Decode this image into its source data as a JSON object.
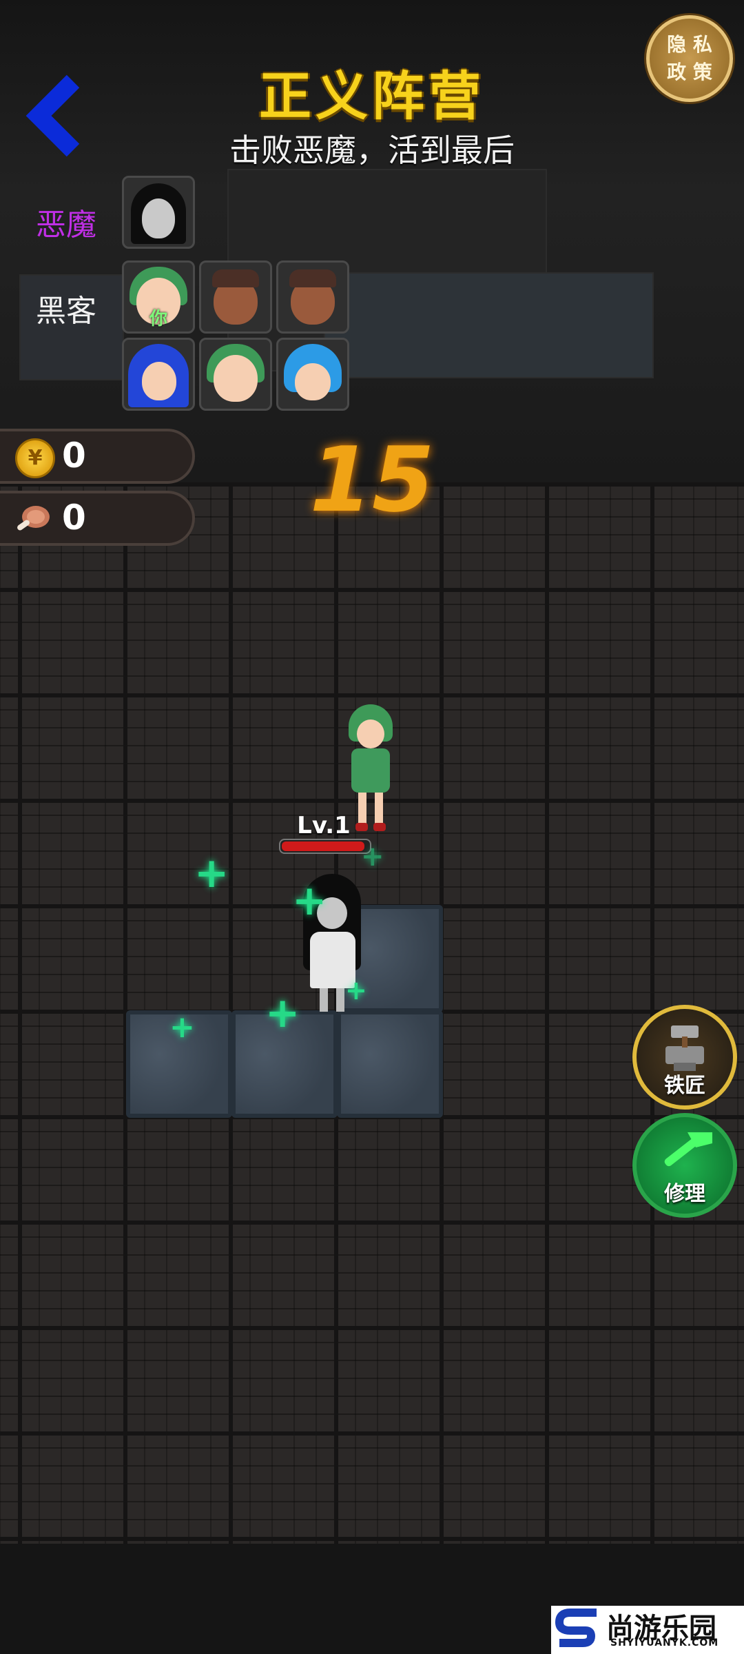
{
  "header": {
    "title": "正义阵营",
    "subtitle": "击败恶魔，活到最后",
    "privacy_label": "隐私政策",
    "privacy_line1": "隐 私",
    "privacy_line2": "政 策"
  },
  "teams": {
    "demon_label": "恶魔",
    "hacker_label": "黑客",
    "you_label": "你",
    "demon_color": "#c02fe6",
    "hacker_color": "#f2f2f2"
  },
  "counters": {
    "coins": "0",
    "meat": "0"
  },
  "game": {
    "countdown": "15",
    "level": "Lv.1",
    "hp_fraction": 0.95
  },
  "side_buttons": {
    "blacksmith": "铁匠",
    "repair": "修理"
  },
  "watermark": {
    "name": "尚游乐园",
    "domain": "SHYIYUANYK.COM"
  }
}
